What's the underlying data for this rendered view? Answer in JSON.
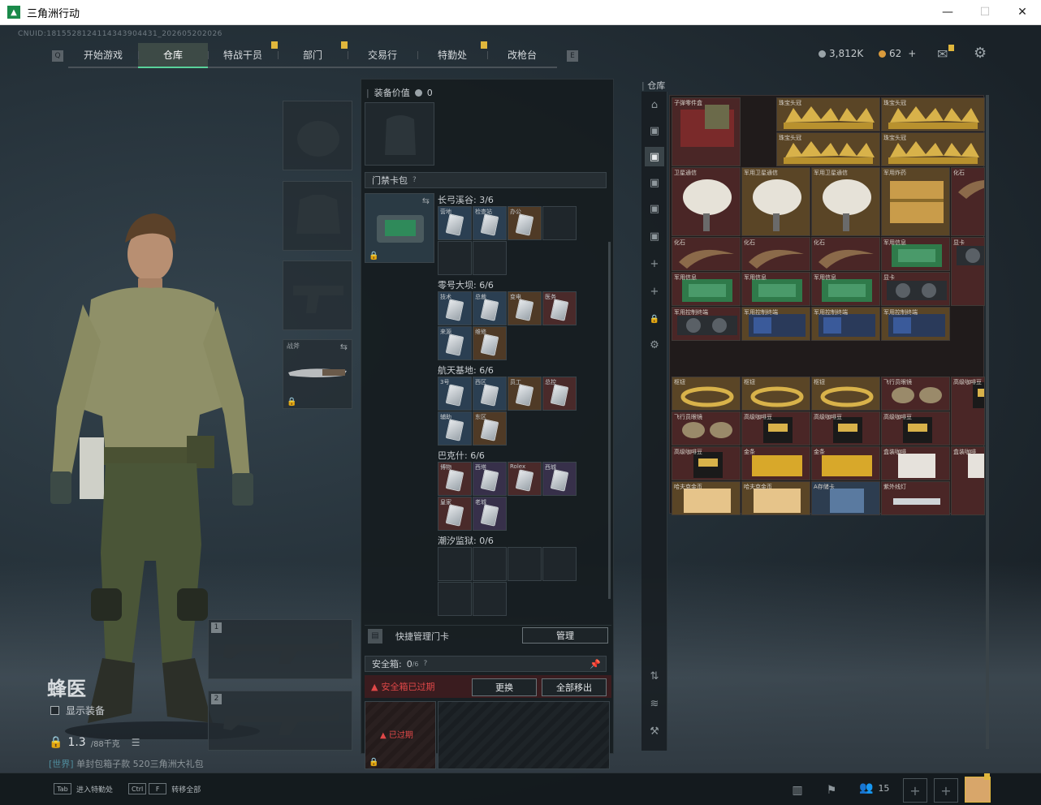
{
  "window": {
    "title": "三角洲行动",
    "minimize": "—",
    "maximize": "☐",
    "close": "✕"
  },
  "header": {
    "uid": "CNUID:1815528124114343904431_202605202026",
    "tabs": [
      {
        "label": "开始游戏",
        "active": false,
        "badge": false
      },
      {
        "label": "仓库",
        "active": true,
        "badge": false
      },
      {
        "label": "特战干员",
        "active": false,
        "badge": true
      },
      {
        "label": "部门",
        "active": false,
        "badge": true
      },
      {
        "label": "交易行",
        "active": false,
        "badge": false
      },
      {
        "label": "特勤处",
        "active": false,
        "badge": true
      },
      {
        "label": "改枪台",
        "active": false,
        "badge": false
      }
    ],
    "currency_silver": "3,812K",
    "currency_gold": "62",
    "currency_plus": "+"
  },
  "operator": {
    "name": "蜂医",
    "show_equipment": "显示装备",
    "weight": "1.3",
    "weight_max": "/88千克",
    "chat_tag": "[世界]",
    "chat_text": "单封包箱子款 520三角洲大礼包"
  },
  "equipment": {
    "melee_label": "战斧",
    "weapon1_num": "1",
    "weapon2_num": "2"
  },
  "middle": {
    "equip_value_label": "装备价值",
    "equip_value": "0",
    "keycard_title": "门禁卡包",
    "keycard_help": "?",
    "groups": [
      {
        "label": "长弓溪谷: 3/6",
        "cards": [
          "营地",
          "检查站",
          "办公"
        ]
      },
      {
        "label": "零号大坝: 6/6",
        "cards": [
          "技术",
          "总裁",
          "变电",
          "医务",
          "来源",
          "维修"
        ]
      },
      {
        "label": "航天基地: 6/6",
        "cards": [
          "3号",
          "西区",
          "员工",
          "总控",
          "辅助",
          "东区"
        ]
      },
      {
        "label": "巴克什: 6/6",
        "cards": [
          "博物",
          "西塔",
          "Rolex",
          "西城",
          "皇家",
          "老城"
        ]
      },
      {
        "label": "潮汐监狱: 0/6",
        "cards": []
      }
    ],
    "quick_manage": "快捷管理门卡",
    "manage_button": "管理",
    "safe_box": "安全箱:",
    "safe_box_count": "0",
    "safe_box_capacity": "/6",
    "safe_expired_msg": "安全箱已过期",
    "replace_button": "更换",
    "move_all_button": "全部移出",
    "expired_tag": "已过期"
  },
  "stash": {
    "title": "仓库",
    "items": [
      {
        "name": "子弹零件盒"
      },
      {
        "name": "珠宝头冠"
      },
      {
        "name": "珠宝头冠"
      },
      {
        "name": "珠宝头冠"
      },
      {
        "name": "珠宝头冠"
      },
      {
        "name": "卫星通信"
      },
      {
        "name": "军用卫星通信"
      },
      {
        "name": "军用卫星通信"
      },
      {
        "name": "军用炸药"
      },
      {
        "name": "化石"
      },
      {
        "name": "化石"
      },
      {
        "name": "化石"
      },
      {
        "name": "化石"
      },
      {
        "name": "军用信息"
      },
      {
        "name": "军用信息"
      },
      {
        "name": "军用信息"
      },
      {
        "name": "军用信息"
      },
      {
        "name": "显卡"
      },
      {
        "name": "显卡"
      },
      {
        "name": "军用控制终端"
      },
      {
        "name": "军用控制终端"
      },
      {
        "name": "军用控制终端"
      },
      {
        "name": "军用控制终端"
      },
      {
        "name": "枢钮"
      },
      {
        "name": "枢钮"
      },
      {
        "name": "枢钮"
      },
      {
        "name": "飞行员眼镜"
      },
      {
        "name": "高级咖啡豆"
      },
      {
        "name": "飞行员眼镜"
      },
      {
        "name": "高级咖啡豆"
      },
      {
        "name": "高级咖啡豆"
      },
      {
        "name": "高级咖啡豆"
      },
      {
        "name": "高级咖啡豆"
      },
      {
        "name": "金条"
      },
      {
        "name": "金条"
      },
      {
        "name": "盒装咖啡"
      },
      {
        "name": "盒装咖啡"
      },
      {
        "name": "哈夫克金币"
      },
      {
        "name": "哈夫克金币"
      },
      {
        "name": "A存储卡"
      },
      {
        "name": "紫外线灯"
      }
    ]
  },
  "bottom": {
    "key1": "Tab",
    "label1": "进入特勤处",
    "key2a": "Ctrl",
    "key2b": "F",
    "label2": "转移全部",
    "friends_count": "15"
  }
}
